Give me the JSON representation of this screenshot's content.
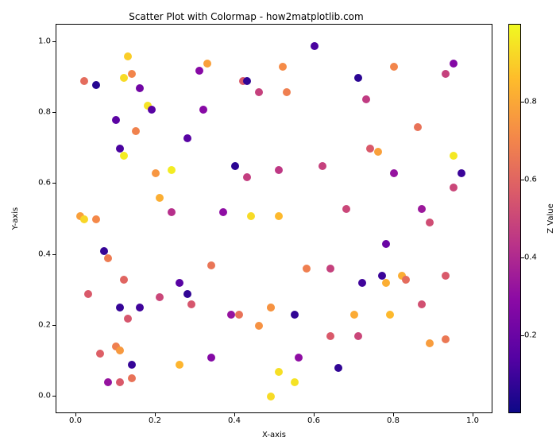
{
  "chart_data": {
    "type": "scatter",
    "title": "Scatter Plot with Colormap - how2matplotlib.com",
    "xlabel": "X-axis",
    "ylabel": "Y-axis",
    "xlim": [
      -0.05,
      1.05
    ],
    "ylim": [
      -0.05,
      1.05
    ],
    "xticks": [
      0.0,
      0.2,
      0.4,
      0.6,
      0.8,
      1.0
    ],
    "yticks": [
      0.0,
      0.2,
      0.4,
      0.6,
      0.8,
      1.0
    ],
    "colorbar": {
      "label": "Z Value",
      "vmin": 0.0,
      "vmax": 1.0,
      "ticks": [
        0.2,
        0.4,
        0.6,
        0.8
      ],
      "cmap": "plasma"
    },
    "points": [
      {
        "x": 0.01,
        "y": 0.51,
        "z": 0.78
      },
      {
        "x": 0.02,
        "y": 0.89,
        "z": 0.62
      },
      {
        "x": 0.03,
        "y": 0.29,
        "z": 0.56
      },
      {
        "x": 0.02,
        "y": 0.5,
        "z": 0.92
      },
      {
        "x": 0.05,
        "y": 0.5,
        "z": 0.71
      },
      {
        "x": 0.05,
        "y": 0.88,
        "z": 0.05
      },
      {
        "x": 0.06,
        "y": 0.12,
        "z": 0.58
      },
      {
        "x": 0.07,
        "y": 0.41,
        "z": 0.08
      },
      {
        "x": 0.08,
        "y": 0.39,
        "z": 0.67
      },
      {
        "x": 0.08,
        "y": 0.04,
        "z": 0.32
      },
      {
        "x": 0.1,
        "y": 0.78,
        "z": 0.16
      },
      {
        "x": 0.1,
        "y": 0.14,
        "z": 0.68
      },
      {
        "x": 0.11,
        "y": 0.04,
        "z": 0.56
      },
      {
        "x": 0.11,
        "y": 0.13,
        "z": 0.76
      },
      {
        "x": 0.11,
        "y": 0.7,
        "z": 0.12
      },
      {
        "x": 0.11,
        "y": 0.25,
        "z": 0.08
      },
      {
        "x": 0.12,
        "y": 0.33,
        "z": 0.6
      },
      {
        "x": 0.12,
        "y": 0.9,
        "z": 0.93
      },
      {
        "x": 0.12,
        "y": 0.68,
        "z": 0.97
      },
      {
        "x": 0.13,
        "y": 0.96,
        "z": 0.9
      },
      {
        "x": 0.13,
        "y": 0.22,
        "z": 0.55
      },
      {
        "x": 0.14,
        "y": 0.91,
        "z": 0.7
      },
      {
        "x": 0.14,
        "y": 0.09,
        "z": 0.08
      },
      {
        "x": 0.14,
        "y": 0.05,
        "z": 0.64
      },
      {
        "x": 0.15,
        "y": 0.75,
        "z": 0.69
      },
      {
        "x": 0.16,
        "y": 0.25,
        "z": 0.1
      },
      {
        "x": 0.16,
        "y": 0.87,
        "z": 0.22
      },
      {
        "x": 0.18,
        "y": 0.82,
        "z": 0.95
      },
      {
        "x": 0.19,
        "y": 0.81,
        "z": 0.15
      },
      {
        "x": 0.2,
        "y": 0.63,
        "z": 0.75
      },
      {
        "x": 0.21,
        "y": 0.56,
        "z": 0.82
      },
      {
        "x": 0.21,
        "y": 0.28,
        "z": 0.5
      },
      {
        "x": 0.24,
        "y": 0.64,
        "z": 0.97
      },
      {
        "x": 0.24,
        "y": 0.52,
        "z": 0.42
      },
      {
        "x": 0.26,
        "y": 0.32,
        "z": 0.15
      },
      {
        "x": 0.26,
        "y": 0.09,
        "z": 0.84
      },
      {
        "x": 0.28,
        "y": 0.73,
        "z": 0.15
      },
      {
        "x": 0.28,
        "y": 0.29,
        "z": 0.07
      },
      {
        "x": 0.29,
        "y": 0.26,
        "z": 0.55
      },
      {
        "x": 0.31,
        "y": 0.92,
        "z": 0.28
      },
      {
        "x": 0.32,
        "y": 0.81,
        "z": 0.28
      },
      {
        "x": 0.33,
        "y": 0.94,
        "z": 0.78
      },
      {
        "x": 0.34,
        "y": 0.11,
        "z": 0.27
      },
      {
        "x": 0.34,
        "y": 0.37,
        "z": 0.65
      },
      {
        "x": 0.37,
        "y": 0.52,
        "z": 0.3
      },
      {
        "x": 0.39,
        "y": 0.23,
        "z": 0.32
      },
      {
        "x": 0.41,
        "y": 0.23,
        "z": 0.64
      },
      {
        "x": 0.42,
        "y": 0.89,
        "z": 0.56
      },
      {
        "x": 0.4,
        "y": 0.65,
        "z": 0.06
      },
      {
        "x": 0.43,
        "y": 0.89,
        "z": 0.07
      },
      {
        "x": 0.43,
        "y": 0.62,
        "z": 0.47
      },
      {
        "x": 0.44,
        "y": 0.51,
        "z": 0.93
      },
      {
        "x": 0.46,
        "y": 0.86,
        "z": 0.48
      },
      {
        "x": 0.46,
        "y": 0.2,
        "z": 0.74
      },
      {
        "x": 0.49,
        "y": 0.25,
        "z": 0.89
      },
      {
        "x": 0.49,
        "y": 0.25,
        "z": 0.74
      },
      {
        "x": 0.49,
        "y": 0.0,
        "z": 0.93
      },
      {
        "x": 0.51,
        "y": 0.64,
        "z": 0.45
      },
      {
        "x": 0.51,
        "y": 0.51,
        "z": 0.85
      },
      {
        "x": 0.51,
        "y": 0.07,
        "z": 0.94
      },
      {
        "x": 0.52,
        "y": 0.93,
        "z": 0.72
      },
      {
        "x": 0.53,
        "y": 0.86,
        "z": 0.68
      },
      {
        "x": 0.55,
        "y": 0.04,
        "z": 0.95
      },
      {
        "x": 0.56,
        "y": 0.11,
        "z": 0.3
      },
      {
        "x": 0.55,
        "y": 0.23,
        "z": 0.07
      },
      {
        "x": 0.58,
        "y": 0.36,
        "z": 0.68
      },
      {
        "x": 0.6,
        "y": 0.99,
        "z": 0.12
      },
      {
        "x": 0.62,
        "y": 0.65,
        "z": 0.48
      },
      {
        "x": 0.64,
        "y": 0.17,
        "z": 0.56
      },
      {
        "x": 0.64,
        "y": 0.36,
        "z": 0.48
      },
      {
        "x": 0.66,
        "y": 0.08,
        "z": 0.07
      },
      {
        "x": 0.68,
        "y": 0.53,
        "z": 0.5
      },
      {
        "x": 0.7,
        "y": 0.23,
        "z": 0.81
      },
      {
        "x": 0.71,
        "y": 0.17,
        "z": 0.5
      },
      {
        "x": 0.71,
        "y": 0.9,
        "z": 0.06
      },
      {
        "x": 0.72,
        "y": 0.32,
        "z": 0.1
      },
      {
        "x": 0.73,
        "y": 0.84,
        "z": 0.46
      },
      {
        "x": 0.74,
        "y": 0.7,
        "z": 0.56
      },
      {
        "x": 0.76,
        "y": 0.69,
        "z": 0.78
      },
      {
        "x": 0.77,
        "y": 0.34,
        "z": 0.09
      },
      {
        "x": 0.78,
        "y": 0.43,
        "z": 0.2
      },
      {
        "x": 0.78,
        "y": 0.32,
        "z": 0.82
      },
      {
        "x": 0.79,
        "y": 0.23,
        "z": 0.85
      },
      {
        "x": 0.8,
        "y": 0.63,
        "z": 0.32
      },
      {
        "x": 0.8,
        "y": 0.93,
        "z": 0.7
      },
      {
        "x": 0.82,
        "y": 0.34,
        "z": 0.82
      },
      {
        "x": 0.83,
        "y": 0.33,
        "z": 0.62
      },
      {
        "x": 0.86,
        "y": 0.76,
        "z": 0.64
      },
      {
        "x": 0.87,
        "y": 0.53,
        "z": 0.34
      },
      {
        "x": 0.87,
        "y": 0.26,
        "z": 0.53
      },
      {
        "x": 0.89,
        "y": 0.49,
        "z": 0.52
      },
      {
        "x": 0.89,
        "y": 0.15,
        "z": 0.77
      },
      {
        "x": 0.93,
        "y": 0.34,
        "z": 0.56
      },
      {
        "x": 0.93,
        "y": 0.16,
        "z": 0.66
      },
      {
        "x": 0.93,
        "y": 0.91,
        "z": 0.48
      },
      {
        "x": 0.95,
        "y": 0.59,
        "z": 0.5
      },
      {
        "x": 0.95,
        "y": 0.94,
        "z": 0.27
      },
      {
        "x": 0.95,
        "y": 0.68,
        "z": 0.96
      },
      {
        "x": 0.97,
        "y": 0.63,
        "z": 0.09
      }
    ]
  }
}
